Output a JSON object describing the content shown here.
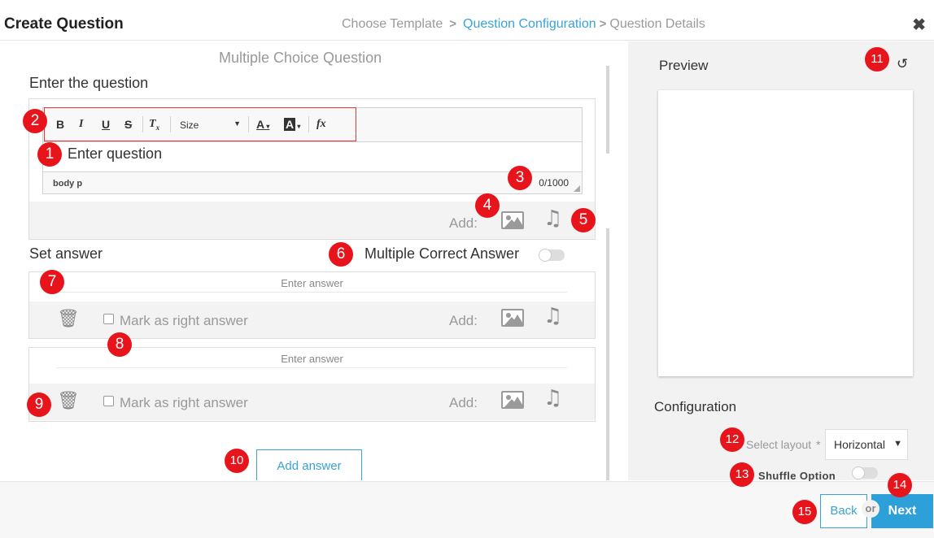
{
  "header": {
    "title": "Create Question",
    "breadcrumbs": [
      "Choose Template",
      "Question Configuration",
      "Question Details"
    ],
    "active_step": "Question Configuration",
    "close_icon": "close-icon"
  },
  "main": {
    "section_title": "Multiple Choice Question",
    "question_label": "Enter the question",
    "editor": {
      "toolbar": {
        "bold": "B",
        "italic": "I",
        "underline": "U",
        "strike": "S",
        "remove_format": "T",
        "remove_format_sub": "x",
        "size_label": "Size",
        "font_color": "A",
        "bg_color": "A",
        "formula": "fx"
      },
      "placeholder": "Enter question",
      "path": "body  p",
      "char_count": "0/1000"
    },
    "add_label": "Add:",
    "set_answer_label": "Set answer",
    "multiple_correct_label": "Multiple Correct Answer",
    "multiple_correct_on": false,
    "answers": [
      {
        "placeholder": "Enter answer",
        "mark_label": "Mark as right answer",
        "add_label": "Add:",
        "checked": false
      },
      {
        "placeholder": "Enter answer",
        "mark_label": "Mark as right answer",
        "add_label": "Add:",
        "checked": false
      }
    ],
    "add_answer_button": "Add answer"
  },
  "preview": {
    "label": "Preview",
    "refresh_icon": "refresh-icon"
  },
  "configuration": {
    "label": "Configuration",
    "layout_label": "Select layout",
    "layout_required": "*",
    "layout_value": "Horizontal",
    "shuffle_label": "Shuffle Option",
    "shuffle_on": false
  },
  "footer": {
    "back": "Back",
    "or": "or",
    "next": "Next"
  },
  "callouts": [
    "1",
    "2",
    "3",
    "4",
    "5",
    "6",
    "7",
    "8",
    "9",
    "10",
    "11",
    "12",
    "13",
    "14",
    "15"
  ],
  "colors": {
    "accent": "#3aa3d6",
    "primary_button": "#2d9fd9",
    "callout": "#e8141b",
    "toolbar_highlight": "#e33333"
  }
}
